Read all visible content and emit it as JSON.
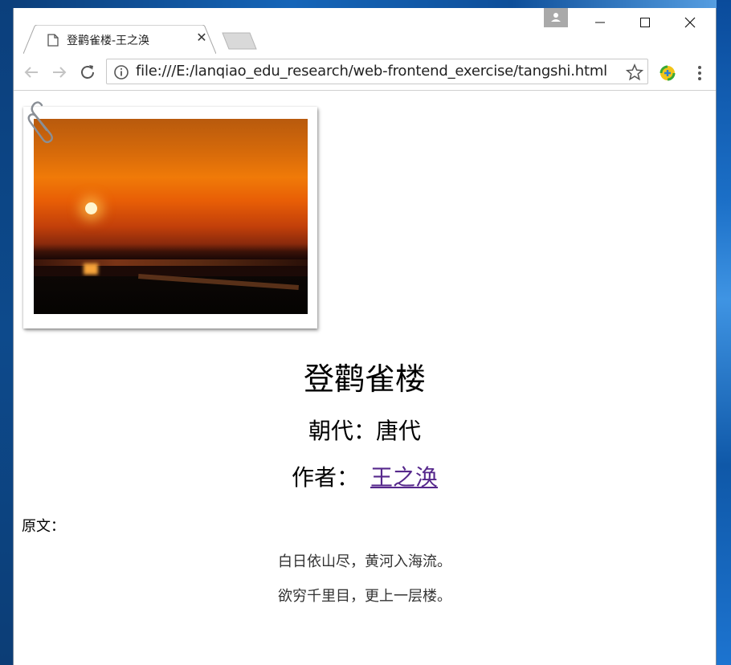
{
  "browser": {
    "tab": {
      "title": "登鹳雀楼-王之涣",
      "close_symbol": "✕"
    },
    "address_bar": {
      "url": "file:///E:/lanqiao_edu_research/web-frontend_exercise/tangshi.html"
    }
  },
  "icons": {
    "tab": "document-icon",
    "back": "back-arrow-icon",
    "forward": "forward-arrow-icon",
    "reload": "reload-icon",
    "info": "info-icon",
    "bookmark": "star-icon",
    "extension": "extension-icon",
    "menu": "three-dot-menu-icon",
    "profile": "profile-icon",
    "photo_clip": "paperclip-icon"
  },
  "page": {
    "title": "登鹳雀楼",
    "dynasty": "朝代：唐代",
    "author_label": "作者：",
    "author_name": "王之涣",
    "original_label": "原文：",
    "verses": [
      "白日依山尽，黄河入海流。",
      "欲穷千里目，更上一层楼。"
    ]
  },
  "colors": {
    "link_visited": "#56288c"
  }
}
